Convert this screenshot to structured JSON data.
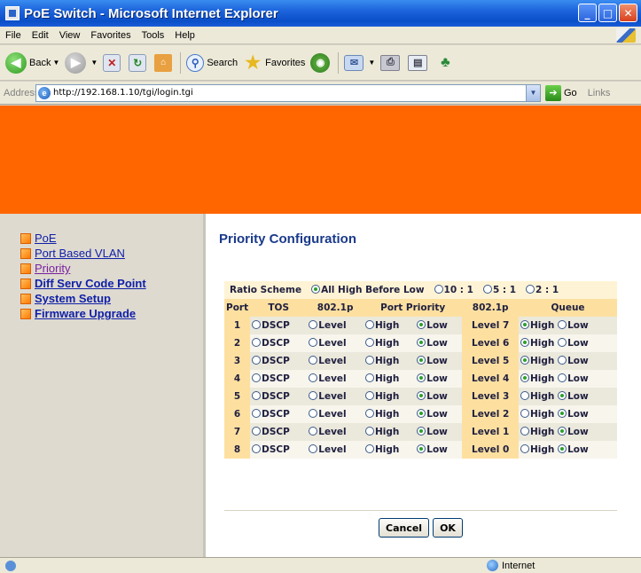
{
  "window": {
    "title": "PoE Switch - Microsoft Internet Explorer"
  },
  "menu": [
    "File",
    "Edit",
    "View",
    "Favorites",
    "Tools",
    "Help"
  ],
  "toolbar": {
    "back": "Back",
    "search": "Search",
    "favorites": "Favorites"
  },
  "address": {
    "label": "Address",
    "url": "http://192.168.1.10/tgi/login.tgi",
    "go": "Go",
    "links": "Links"
  },
  "sidebar": {
    "items": [
      {
        "label": "PoE"
      },
      {
        "label": "Port Based VLAN"
      },
      {
        "label": "Priority"
      },
      {
        "label": "Diff Serv Code Point"
      },
      {
        "label": "System Setup"
      },
      {
        "label": "Firmware Upgrade"
      }
    ]
  },
  "main": {
    "title": "Priority Configuration",
    "ratio": {
      "label": "Ratio Scheme",
      "options": [
        "All High Before Low",
        "10 : 1",
        "5 : 1",
        "2 : 1"
      ],
      "selected": "All High Before Low"
    },
    "headers": [
      "Port",
      "TOS",
      "802.1p",
      "Port Priority",
      "802.1p",
      "Queue"
    ],
    "rows": [
      {
        "port": "1",
        "tos": "DSCP",
        "p8021": "Level",
        "pp_high": "High",
        "pp_low": "Low",
        "pp_sel": "Low",
        "level": "Level 7",
        "q_high": "High",
        "q_low": "Low",
        "q_sel": "High"
      },
      {
        "port": "2",
        "tos": "DSCP",
        "p8021": "Level",
        "pp_high": "High",
        "pp_low": "Low",
        "pp_sel": "Low",
        "level": "Level 6",
        "q_high": "High",
        "q_low": "Low",
        "q_sel": "High"
      },
      {
        "port": "3",
        "tos": "DSCP",
        "p8021": "Level",
        "pp_high": "High",
        "pp_low": "Low",
        "pp_sel": "Low",
        "level": "Level 5",
        "q_high": "High",
        "q_low": "Low",
        "q_sel": "High"
      },
      {
        "port": "4",
        "tos": "DSCP",
        "p8021": "Level",
        "pp_high": "High",
        "pp_low": "Low",
        "pp_sel": "Low",
        "level": "Level 4",
        "q_high": "High",
        "q_low": "Low",
        "q_sel": "High"
      },
      {
        "port": "5",
        "tos": "DSCP",
        "p8021": "Level",
        "pp_high": "High",
        "pp_low": "Low",
        "pp_sel": "Low",
        "level": "Level 3",
        "q_high": "High",
        "q_low": "Low",
        "q_sel": "Low"
      },
      {
        "port": "6",
        "tos": "DSCP",
        "p8021": "Level",
        "pp_high": "High",
        "pp_low": "Low",
        "pp_sel": "Low",
        "level": "Level 2",
        "q_high": "High",
        "q_low": "Low",
        "q_sel": "Low"
      },
      {
        "port": "7",
        "tos": "DSCP",
        "p8021": "Level",
        "pp_high": "High",
        "pp_low": "Low",
        "pp_sel": "Low",
        "level": "Level 1",
        "q_high": "High",
        "q_low": "Low",
        "q_sel": "Low"
      },
      {
        "port": "8",
        "tos": "DSCP",
        "p8021": "Level",
        "pp_high": "High",
        "pp_low": "Low",
        "pp_sel": "Low",
        "level": "Level 0",
        "q_high": "High",
        "q_low": "Low",
        "q_sel": "Low"
      }
    ],
    "buttons": {
      "cancel": "Cancel",
      "ok": "OK"
    }
  },
  "status": {
    "zone": "Internet"
  },
  "colors": {
    "banner": "#ff6600",
    "header_bg": "#fde0a0",
    "title_blue": "#1a3a8a",
    "radio_selected": "#2aa02a"
  }
}
